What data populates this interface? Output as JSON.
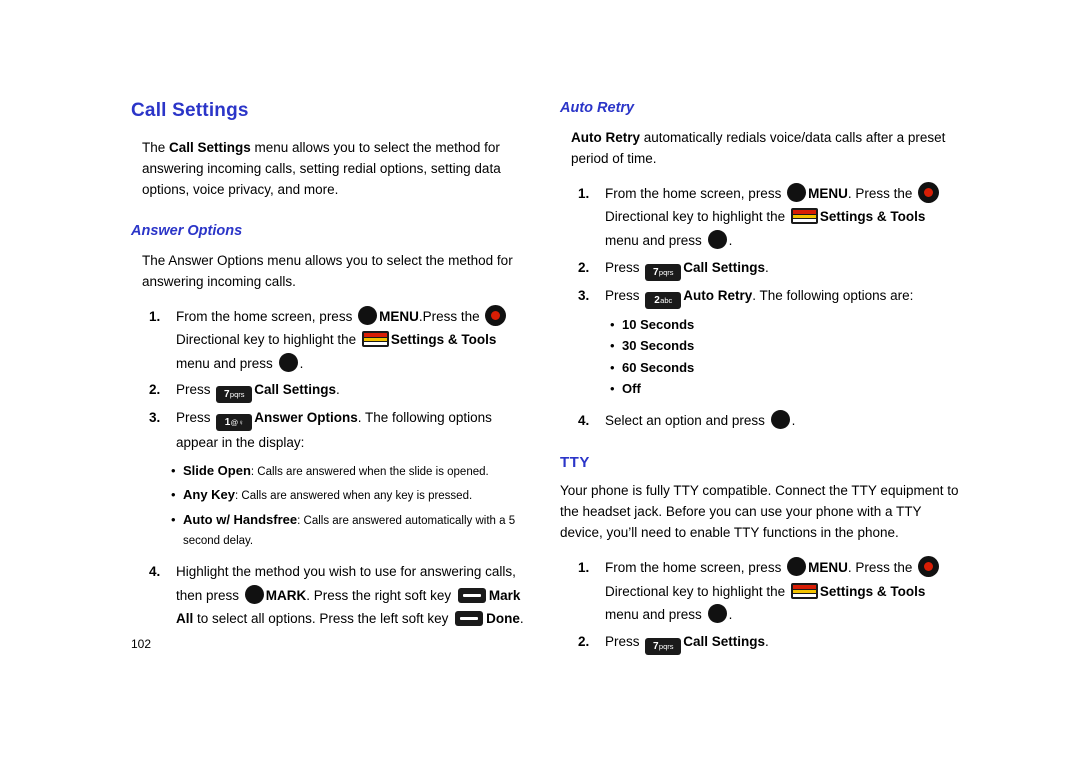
{
  "page": {
    "number": "102"
  },
  "left": {
    "title": "Call Settings",
    "intro_pre": "The ",
    "intro_bold": "Call Settings",
    "intro_post": " menu allows you to select the method for answering incoming calls, setting redial options, setting data options, voice privacy, and more.",
    "answer_options": {
      "title": "Answer Options",
      "intro": "The Answer Options menu allows you to select the method for answering incoming calls.",
      "steps": [
        {
          "num": "1.",
          "t1": "From the home screen, press ",
          "k1": "ok-key-icon",
          "t2": "MENU",
          "t3": ".Press the ",
          "k2": "red-ok-key-icon",
          "t4": "Directional key to highlight the ",
          "k3": "settings-tools-icon",
          "t5": "Settings & Tools",
          "t6": " menu and press ",
          "k4": "ok-key-icon",
          "t7": "."
        },
        {
          "num": "2.",
          "t1": "Press ",
          "key": "7",
          "key_sup": "pqrs",
          "t2": "Call Settings",
          "t3": "."
        },
        {
          "num": "3.",
          "t1": "Press ",
          "key": "1",
          "key_sup": "@♀",
          "t2": "Answer Options",
          "t3": ". The following options appear in the display:"
        }
      ],
      "bullets": [
        {
          "bold": "Slide Open",
          "rest": ": Calls are answered when the slide is opened."
        },
        {
          "bold": "Any Key",
          "rest": ": Calls are answered when any key is pressed."
        },
        {
          "bold": "Auto w/ Handsfree",
          "rest": ": Calls are answered automatically with a 5 second delay."
        }
      ],
      "step4": {
        "num": "4.",
        "t1": "Highlight the method you wish to use for answering calls, then press ",
        "k1": "ok-key-icon",
        "t2": "MARK",
        "t3": ". Press the right soft key ",
        "k2": "soft-key-icon",
        "t4": "Mark All",
        "t5": " to select all options. Press the left soft key ",
        "k3": "soft-key-icon",
        "t6": "Done",
        "t7": "."
      }
    }
  },
  "right": {
    "auto_retry": {
      "title": "Auto Retry",
      "intro_bold": "Auto Retry",
      "intro_rest": " automatically redials voice/data calls after a preset period of time.",
      "steps": [
        {
          "num": "1.",
          "t1": "From the home screen, press ",
          "k1": "ok-key-icon",
          "t2": "MENU",
          "t3": ". Press the ",
          "k2": "red-ok-key-icon",
          "t4": "Directional key to highlight the ",
          "k3": "settings-tools-icon",
          "t5": "Settings & Tools",
          "t6": " menu and press ",
          "k4": "ok-key-icon",
          "t7": "."
        },
        {
          "num": "2.",
          "t1": "Press ",
          "key": "7",
          "key_sup": "pqrs",
          "t2": "Call Settings",
          "t3": "."
        },
        {
          "num": "3.",
          "t1": "Press ",
          "key": "2",
          "key_sup": "abc",
          "t2": "Auto Retry",
          "t3": ". The following options are:"
        }
      ],
      "bullets": [
        "10 Seconds",
        "30 Seconds",
        "60 Seconds",
        "Off"
      ],
      "step4": {
        "num": "4.",
        "t1": "Select an option and press ",
        "k1": "ok-key-icon",
        "t2": "."
      }
    },
    "tty": {
      "title": "TTY",
      "intro": "Your phone is fully TTY compatible. Connect the TTY equipment to the headset jack. Before you can use your phone with a TTY device, you’ll need to enable TTY functions in the phone.",
      "steps": [
        {
          "num": "1.",
          "t1": "From the home screen, press ",
          "k1": "ok-key-icon",
          "t2": "MENU",
          "t3": ". Press the ",
          "k2": "red-ok-key-icon",
          "t4": "Directional key to highlight the ",
          "k3": "settings-tools-icon",
          "t5": "Settings & Tools",
          "t6": " menu and press ",
          "k4": "ok-key-icon",
          "t7": "."
        },
        {
          "num": "2.",
          "t1": "Press ",
          "key": "7",
          "key_sup": "pqrs",
          "t2": "Call Settings",
          "t3": "."
        }
      ]
    }
  },
  "colors": {
    "heading": "#2b35c8",
    "key_red": "#d81e05",
    "key_black": "#111111"
  }
}
